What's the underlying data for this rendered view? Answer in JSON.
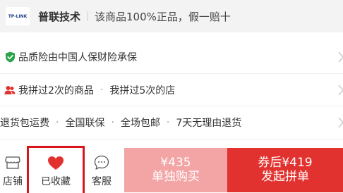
{
  "store": {
    "logo_text": "TP-LINK",
    "name": "普联技术",
    "slogan": "该商品100%正品，假一赔十"
  },
  "guarantee": {
    "text": "品质险由中国人保财险承保",
    "icon": "shield-check-icon",
    "icon_color": "#2aa34a"
  },
  "history": {
    "icon": "users-icon",
    "icon_color": "#e2322f",
    "text1": "我拼过2次的商品",
    "sep": "·",
    "text2": "我拼过5次的店"
  },
  "services": {
    "items": [
      "退货包运费",
      "全国联保",
      "全场包邮",
      "7天无理由退货"
    ],
    "sep": "·"
  },
  "bottom_bar": {
    "store_label": "店铺",
    "favorite_label": "已收藏",
    "service_label": "客服",
    "solo_price": "¥435",
    "solo_label": "单独购买",
    "group_price": "券后¥419",
    "group_label": "发起拼单",
    "accent_color": "#e2322f",
    "favorite_highlight_color": "#d8151d"
  }
}
